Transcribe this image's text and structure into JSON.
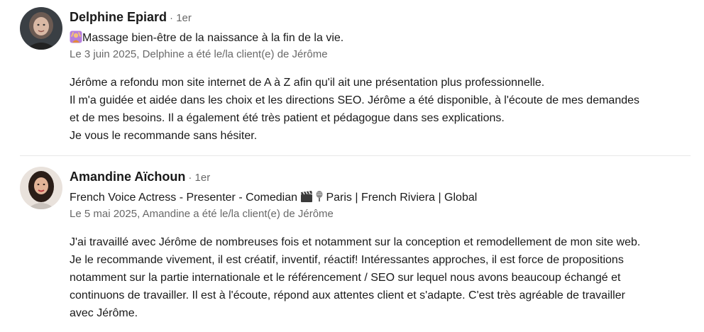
{
  "recommendations": [
    {
      "name": "Delphine Epiard",
      "degree": "· 1er",
      "headline_emoji": "woman-raising-hands-icon",
      "headline": "Massage bien-être de la naissance à la fin de la vie.",
      "meta": "Le 3 juin 2025, Delphine a été le/la client(e) de Jérôme",
      "text_lines": [
        "Jérôme a refondu mon site internet de A à Z afin qu'il ait une présentation plus professionnelle.",
        "Il m'a guidée et aidée dans les choix et les directions SEO. Jérôme a été disponible, à l'écoute de mes demandes",
        "et de mes besoins. Il a également été très patient et pédagogue dans ses explications.",
        "Je vous le recommande sans hésiter."
      ]
    },
    {
      "name": "Amandine Aïchoun",
      "degree": "· 1er",
      "headline_part1": "French Voice Actress - Presenter - Comedian ",
      "headline_icons": [
        "clapperboard-icon",
        "microphone-icon"
      ],
      "headline_part2": "Paris | French Riviera | Global",
      "meta": "Le 5 mai 2025, Amandine a été le/la client(e) de Jérôme",
      "text_lines": [
        "J'ai travaillé avec Jérôme de nombreuses fois et notamment sur la conception et remodellement de mon site web.",
        "Je le recommande vivement, il est créatif, inventif, réactif! Intéressantes approches, il est force de propositions",
        "notamment sur la partie internationale et le référencement / SEO sur lequel nous avons beaucoup échangé et",
        "continuons de travailler. Il est à l'écoute, répond aux attentes client et s'adapte. C'est très agréable de travailler",
        "avec Jérôme."
      ]
    }
  ]
}
